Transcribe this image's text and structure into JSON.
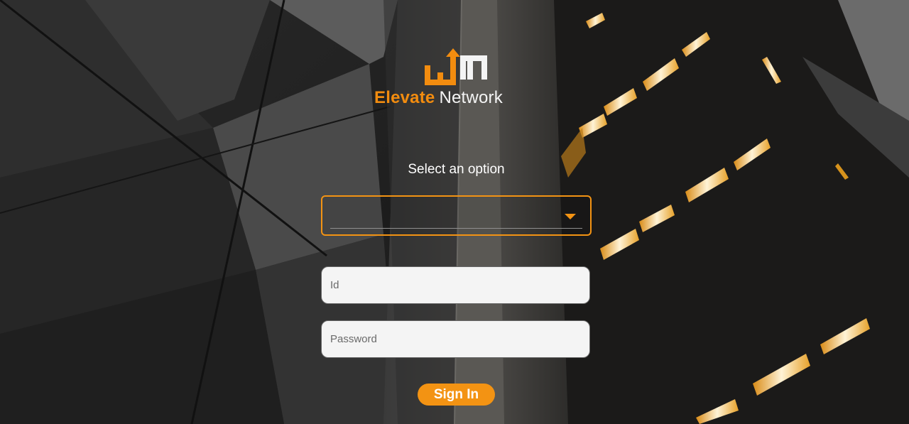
{
  "brand": {
    "name_part_1": "Elevate",
    "name_part_2": "Network",
    "accent_color": "#f39313",
    "logo_icon": "bar-chart-arrow-icon"
  },
  "form": {
    "select_label": "Select an option",
    "select_value": "",
    "select_icon": "caret-down-icon",
    "id_placeholder": "Id",
    "password_placeholder": "Password",
    "signin_label": "Sign In"
  }
}
